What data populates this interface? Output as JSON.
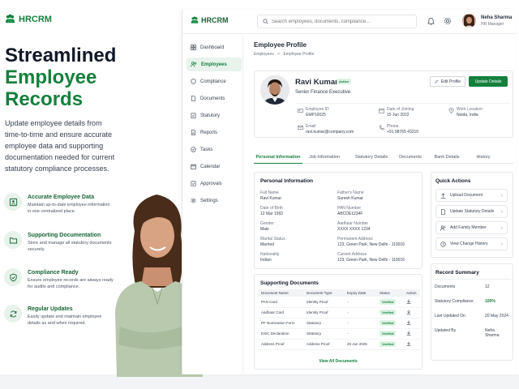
{
  "brand": {
    "name": "HRCRM"
  },
  "hero": {
    "title_line1": "Streamlined",
    "title_line2": "Employee",
    "title_line3": "Records",
    "paragraph": "Update employee details from time-to-time and ensure accurate employee data and supporting documentation needed for current statutory compliance processes."
  },
  "features": [
    {
      "title": "Accurate Employee Data",
      "desc": "Maintain up-to-date employee information in one centralized place.",
      "icon": "id-card-icon"
    },
    {
      "title": "Supporting Documentation",
      "desc": "Store and manage all statutory documents securely.",
      "icon": "folder-icon"
    },
    {
      "title": "Compliance Ready",
      "desc": "Ensure employee records are always ready for audits and compliance.",
      "icon": "shield-check-icon"
    },
    {
      "title": "Regular Updates",
      "desc": "Easily update and maintain employee details as and when required.",
      "icon": "refresh-icon"
    }
  ],
  "topbar": {
    "logo": "HRCRM",
    "search_placeholder": "Search employees, documents, compliance...",
    "user_name": "Neha Sharma",
    "user_role": "HR Manager"
  },
  "sidebar": {
    "items": [
      "Dashboard",
      "Employees",
      "Compliance",
      "Documents",
      "Statutory",
      "Reports",
      "Tasks",
      "Calendar",
      "Approvals",
      "Settings"
    ],
    "active": "Employees"
  },
  "page": {
    "title": "Employee Profile",
    "breadcrumb_root": "Employees",
    "breadcrumb_sep": ">",
    "breadcrumb_leaf": "Employee Profile"
  },
  "profile": {
    "name": "Ravi Kumar",
    "status": "Active",
    "designation": "Senior Finance Executive",
    "employee_id_label": "Employee ID",
    "employee_id": "EMP10025",
    "doj_label": "Date of Joining",
    "doj": "15 Jun 2022",
    "work_location_label": "Work Location",
    "work_location": "Noida, India",
    "email_label": "Email",
    "email": "ravi.kumar@company.com",
    "phone_label": "Phone",
    "phone": "+91 98765 43210",
    "edit_label": "Edit Profile",
    "update_label": "Update Details"
  },
  "tabs": [
    "Personal Information",
    "Job Information",
    "Statutory Details",
    "Documents",
    "Bank Details",
    "History"
  ],
  "personal": {
    "title": "Personal Information",
    "full_name_label": "Full Name",
    "full_name": "Ravi Kumar",
    "father_label": "Father's Name",
    "father": "Suresh Kumar",
    "dob_label": "Date of Birth",
    "dob": "12 Mar 1992",
    "pan_label": "PAN Number",
    "pan": "ABCDE1234F",
    "gender_label": "Gender",
    "gender": "Male",
    "aadhaar_label": "Aadhaar Number",
    "aadhaar": "XXXX XXXX 1234",
    "marital_label": "Marital Status",
    "marital": "Married",
    "perm_label": "Permanent Address",
    "perm": "123, Green Park, New Delhi - 110016",
    "nat_label": "Nationality",
    "nat": "Indian",
    "curr_label": "Current Address",
    "curr": "123, Green Park, New Delhi - 110016"
  },
  "docs": {
    "title": "Supporting Documents",
    "headers": [
      "Document Name",
      "Document Type",
      "Expiry Date",
      "Status",
      "Action"
    ],
    "rows": [
      [
        "PAN Card",
        "Identity Proof",
        "-",
        "Verified"
      ],
      [
        "Aadhaar Card",
        "Identity Proof",
        "-",
        "Verified"
      ],
      [
        "PF Nomination Form",
        "Statutory",
        "-",
        "Verified"
      ],
      [
        "ESIC Declaration",
        "Statutory",
        "-",
        "Verified"
      ],
      [
        "Address Proof",
        "Address Proof",
        "20 Jun 2025",
        "Verified"
      ]
    ],
    "view_all": "View All Documents"
  },
  "quick_actions": {
    "title": "Quick Actions",
    "items": [
      "Upload Document",
      "Update Statutory Details",
      "Add Family Member",
      "View Change History"
    ]
  },
  "record_summary": {
    "title": "Record Summary",
    "documents_label": "Documents",
    "documents": "12",
    "compliance_label": "Statutory Compliance",
    "compliance": "100%",
    "last_updated_label": "Last Updated On",
    "last_updated": "20 May 2024",
    "updated_by_label": "Updated By",
    "updated_by": "Neha Sharma"
  }
}
